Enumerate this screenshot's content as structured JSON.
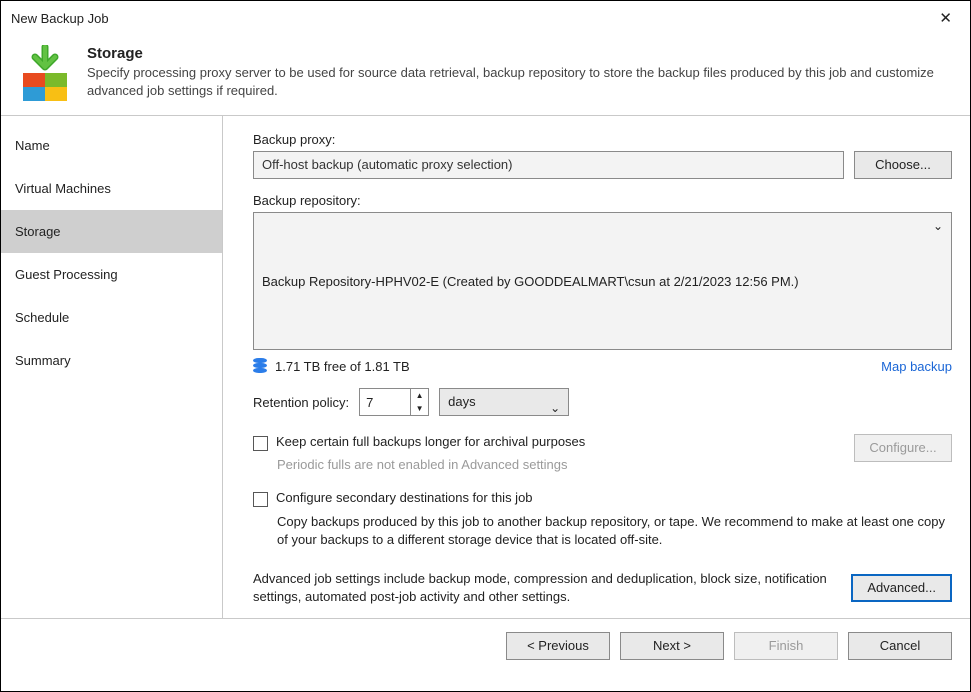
{
  "window": {
    "title": "New Backup Job"
  },
  "header": {
    "title": "Storage",
    "description": "Specify processing proxy server to be used for source data retrieval, backup repository to store the backup files produced by this job and customize advanced job settings if required."
  },
  "sidebar": {
    "items": [
      {
        "label": "Name"
      },
      {
        "label": "Virtual Machines"
      },
      {
        "label": "Storage"
      },
      {
        "label": "Guest Processing"
      },
      {
        "label": "Schedule"
      },
      {
        "label": "Summary"
      }
    ],
    "active_index": 2
  },
  "main": {
    "proxy_label": "Backup proxy:",
    "proxy_value": "Off-host backup (automatic proxy selection)",
    "choose_btn": "Choose...",
    "repo_label": "Backup repository:",
    "repo_value": "Backup Repository-HPHV02-E (Created by GOODDEALMART\\csun at 2/21/2023 12:56 PM.)",
    "free_space": "1.71 TB free of 1.81 TB",
    "map_backup": "Map backup",
    "retention_label": "Retention policy:",
    "retention_value": "7",
    "retention_unit": "days",
    "keep_full_label": "Keep certain full backups longer for archival purposes",
    "keep_full_sub": "Periodic fulls are not enabled in Advanced settings",
    "configure_btn": "Configure...",
    "secondary_label": "Configure secondary destinations for this job",
    "secondary_desc": "Copy backups produced by this job to another backup repository, or tape. We recommend to make at least one copy of your backups to a different storage device that is located off-site.",
    "advanced_note": "Advanced job settings include backup mode, compression and deduplication, block size, notification settings, automated post-job activity and other settings.",
    "advanced_btn": "Advanced..."
  },
  "footer": {
    "prev": "< Previous",
    "next": "Next >",
    "finish": "Finish",
    "cancel": "Cancel"
  }
}
